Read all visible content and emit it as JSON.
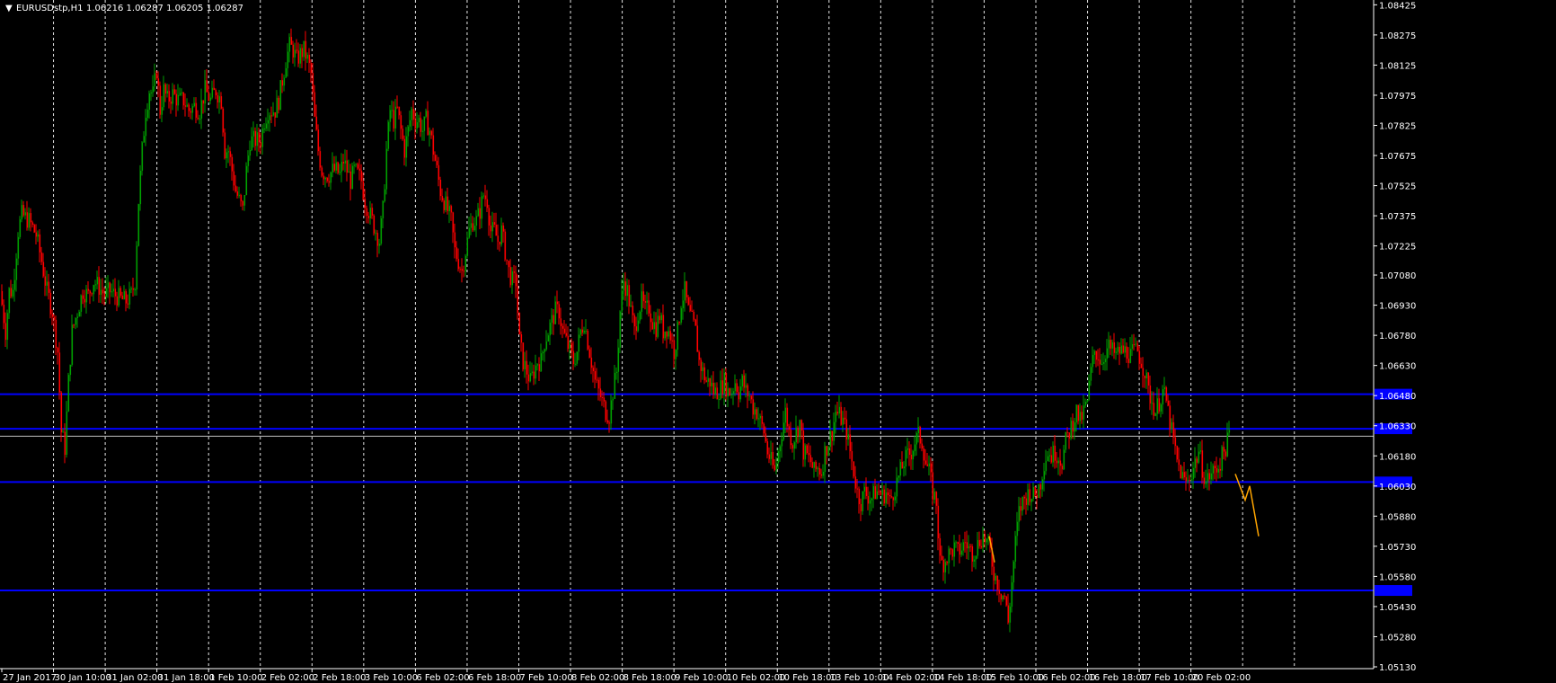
{
  "window": {
    "symbol_title": "EURUSDstp,H1",
    "ohlc_readout": "1.06216 1.06287 1.06205 1.06287",
    "menu_icon": "triangle-down-icon"
  },
  "colors": {
    "background": "#000000",
    "bull": "#00a000",
    "bear": "#ff0000",
    "grid": "#ffffff",
    "level": "#0000ff",
    "level_label_bg": "#0000ff",
    "bid_line": "#c0c0c0",
    "forecast": "#ffa500",
    "axis": "#ffffff"
  },
  "chart_data": {
    "type": "candlestick",
    "symbol": "EURUSDstp",
    "timeframe": "H1",
    "ylim": [
      1.0513,
      1.0844
    ],
    "y_ticks": [
      "1.08425",
      "1.08275",
      "1.08125",
      "1.07975",
      "1.07825",
      "1.07675",
      "1.07525",
      "1.07375",
      "1.07225",
      "1.07080",
      "1.06930",
      "1.06780",
      "1.06630",
      "1.06480",
      "1.06330",
      "1.06180",
      "1.06030",
      "1.05880",
      "1.05730",
      "1.05580",
      "1.05430",
      "1.05280",
      "1.05130"
    ],
    "x_ticks": [
      "27 Jan 2017",
      "30 Jan 10:00",
      "31 Jan 02:00",
      "31 Jan 18:00",
      "1 Feb 10:00",
      "2 Feb 02:00",
      "2 Feb 18:00",
      "3 Feb 10:00",
      "6 Feb 02:00",
      "6 Feb 18:00",
      "7 Feb 10:00",
      "8 Feb 02:00",
      "8 Feb 18:00",
      "9 Feb 10:00",
      "10 Feb 02:00",
      "10 Feb 18:00",
      "13 Feb 10:00",
      "14 Feb 02:00",
      "14 Feb 18:00",
      "15 Feb 10:00",
      "16 Feb 02:00",
      "16 Feb 18:00",
      "17 Feb 10:00",
      "20 Feb 02:00"
    ],
    "grid": "vertical dashed",
    "horizontal_levels": [
      1.06487,
      1.06315,
      1.0605,
      1.0551
    ],
    "current_price": 1.06287,
    "key_points": [
      [
        0,
        1.07
      ],
      [
        6,
        1.068
      ],
      [
        10,
        1.07
      ],
      [
        14,
        1.07
      ],
      [
        20,
        1.073
      ],
      [
        24,
        1.0738
      ],
      [
        32,
        1.0735
      ],
      [
        40,
        1.0728
      ],
      [
        46,
        1.0715
      ],
      [
        52,
        1.07
      ],
      [
        58,
        1.069
      ],
      [
        64,
        1.067
      ],
      [
        68,
        1.063
      ],
      [
        72,
        1.0622
      ],
      [
        76,
        1.0655
      ],
      [
        80,
        1.068
      ],
      [
        86,
        1.069
      ],
      [
        92,
        1.07
      ],
      [
        98,
        1.0698
      ],
      [
        104,
        1.0705
      ],
      [
        110,
        1.0702
      ],
      [
        116,
        1.0698
      ],
      [
        122,
        1.07
      ],
      [
        128,
        1.0698
      ],
      [
        134,
        1.0696
      ],
      [
        140,
        1.0695
      ],
      [
        146,
        1.0698
      ],
      [
        150,
        1.0705
      ],
      [
        154,
        1.0745
      ],
      [
        158,
        1.077
      ],
      [
        162,
        1.079
      ],
      [
        166,
        1.08
      ],
      [
        170,
        1.0798
      ],
      [
        174,
        1.081
      ],
      [
        178,
        1.079
      ],
      [
        182,
        1.08
      ],
      [
        186,
        1.0795
      ],
      [
        192,
        1.0798
      ],
      [
        198,
        1.0795
      ],
      [
        204,
        1.0795
      ],
      [
        210,
        1.079
      ],
      [
        216,
        1.0792
      ],
      [
        222,
        1.079
      ],
      [
        228,
        1.08
      ],
      [
        234,
        1.0795
      ],
      [
        240,
        1.08
      ],
      [
        246,
        1.0795
      ],
      [
        250,
        1.077
      ],
      [
        254,
        1.077
      ],
      [
        258,
        1.076
      ],
      [
        262,
        1.075
      ],
      [
        266,
        1.0745
      ],
      [
        270,
        1.074
      ],
      [
        274,
        1.076
      ],
      [
        278,
        1.0775
      ],
      [
        282,
        1.0775
      ],
      [
        286,
        1.0775
      ],
      [
        290,
        1.0775
      ],
      [
        294,
        1.0785
      ],
      [
        298,
        1.079
      ],
      [
        302,
        1.079
      ],
      [
        306,
        1.079
      ],
      [
        310,
        1.0795
      ],
      [
        314,
        1.0805
      ],
      [
        318,
        1.0815
      ],
      [
        322,
        1.0822
      ],
      [
        326,
        1.082
      ],
      [
        330,
        1.0815
      ],
      [
        334,
        1.0818
      ],
      [
        338,
        1.082
      ],
      [
        342,
        1.0815
      ],
      [
        346,
        1.0808
      ],
      [
        350,
        1.0785
      ],
      [
        354,
        1.077
      ],
      [
        358,
        1.076
      ],
      [
        362,
        1.0758
      ],
      [
        366,
        1.0758
      ],
      [
        370,
        1.076
      ],
      [
        374,
        1.076
      ],
      [
        378,
        1.0758
      ],
      [
        382,
        1.0765
      ],
      [
        386,
        1.076
      ],
      [
        390,
        1.0755
      ],
      [
        394,
        1.076
      ],
      [
        398,
        1.0758
      ],
      [
        402,
        1.0755
      ],
      [
        406,
        1.0745
      ],
      [
        410,
        1.074
      ],
      [
        414,
        1.0735
      ],
      [
        418,
        1.073
      ],
      [
        422,
        1.0725
      ],
      [
        426,
        1.074
      ],
      [
        430,
        1.077
      ],
      [
        434,
        1.079
      ],
      [
        438,
        1.0785
      ],
      [
        442,
        1.079
      ],
      [
        446,
        1.078
      ],
      [
        450,
        1.077
      ],
      [
        454,
        1.078
      ],
      [
        458,
        1.079
      ],
      [
        462,
        1.0785
      ],
      [
        466,
        1.0785
      ],
      [
        470,
        1.078
      ],
      [
        474,
        1.0785
      ],
      [
        478,
        1.078
      ],
      [
        482,
        1.077
      ],
      [
        486,
        1.076
      ],
      [
        490,
        1.075
      ],
      [
        494,
        1.0745
      ],
      [
        498,
        1.074
      ],
      [
        502,
        1.0735
      ],
      [
        506,
        1.072
      ],
      [
        510,
        1.0715
      ],
      [
        514,
        1.071
      ],
      [
        518,
        1.072
      ],
      [
        522,
        1.073
      ],
      [
        526,
        1.0735
      ],
      [
        530,
        1.0735
      ],
      [
        534,
        1.074
      ],
      [
        538,
        1.0748
      ],
      [
        542,
        1.0745
      ],
      [
        546,
        1.073
      ],
      [
        550,
        1.073
      ],
      [
        554,
        1.0725
      ],
      [
        558,
        1.073
      ],
      [
        562,
        1.072
      ],
      [
        566,
        1.071
      ],
      [
        570,
        1.0705
      ],
      [
        574,
        1.0705
      ],
      [
        578,
        1.0675
      ],
      [
        582,
        1.0665
      ],
      [
        586,
        1.066
      ],
      [
        590,
        1.0655
      ],
      [
        594,
        1.066
      ],
      [
        598,
        1.0665
      ],
      [
        602,
        1.0665
      ],
      [
        606,
        1.0675
      ],
      [
        610,
        1.068
      ],
      [
        614,
        1.0685
      ],
      [
        618,
        1.069
      ],
      [
        622,
        1.069
      ],
      [
        626,
        1.068
      ],
      [
        630,
        1.0675
      ],
      [
        634,
        1.067
      ],
      [
        638,
        1.0665
      ],
      [
        642,
        1.067
      ],
      [
        646,
        1.068
      ],
      [
        650,
        1.0685
      ],
      [
        654,
        1.0675
      ],
      [
        658,
        1.0665
      ],
      [
        662,
        1.0655
      ],
      [
        666,
        1.065
      ],
      [
        670,
        1.0645
      ],
      [
        674,
        1.064
      ],
      [
        678,
        1.0638
      ],
      [
        682,
        1.065
      ],
      [
        686,
        1.066
      ],
      [
        690,
        1.069
      ],
      [
        694,
        1.0705
      ],
      [
        698,
        1.07
      ],
      [
        702,
        1.069
      ],
      [
        706,
        1.068
      ],
      [
        710,
        1.069
      ],
      [
        714,
        1.0695
      ],
      [
        718,
        1.069
      ],
      [
        722,
        1.0692
      ],
      [
        726,
        1.0685
      ],
      [
        730,
        1.0682
      ],
      [
        734,
        1.0688
      ],
      [
        738,
        1.068
      ],
      [
        742,
        1.0682
      ],
      [
        746,
        1.0678
      ],
      [
        750,
        1.067
      ],
      [
        754,
        1.068
      ],
      [
        758,
        1.0695
      ],
      [
        762,
        1.07
      ],
      [
        766,
        1.069
      ],
      [
        770,
        1.0685
      ],
      [
        774,
        1.068
      ],
      [
        778,
        1.0665
      ],
      [
        782,
        1.066
      ],
      [
        786,
        1.0655
      ],
      [
        790,
        1.0655
      ],
      [
        794,
        1.065
      ],
      [
        798,
        1.065
      ],
      [
        802,
        1.0652
      ],
      [
        806,
        1.0655
      ],
      [
        810,
        1.065
      ],
      [
        814,
        1.065
      ],
      [
        818,
        1.0655
      ],
      [
        822,
        1.065
      ],
      [
        826,
        1.0655
      ],
      [
        830,
        1.065
      ],
      [
        834,
        1.0648
      ],
      [
        838,
        1.0642
      ],
      [
        842,
        1.064
      ],
      [
        846,
        1.0635
      ],
      [
        850,
        1.063
      ],
      [
        854,
        1.062
      ],
      [
        858,
        1.0615
      ],
      [
        862,
        1.061
      ],
      [
        866,
        1.062
      ],
      [
        870,
        1.063
      ],
      [
        874,
        1.064
      ],
      [
        878,
        1.063
      ],
      [
        882,
        1.0625
      ],
      [
        886,
        1.063
      ],
      [
        890,
        1.0635
      ],
      [
        894,
        1.062
      ],
      [
        898,
        1.0618
      ],
      [
        902,
        1.0615
      ],
      [
        906,
        1.061
      ],
      [
        910,
        1.0612
      ],
      [
        914,
        1.061
      ],
      [
        918,
        1.062
      ],
      [
        922,
        1.0625
      ],
      [
        926,
        1.063
      ],
      [
        930,
        1.064
      ],
      [
        934,
        1.0638
      ],
      [
        938,
        1.0635
      ],
      [
        942,
        1.063
      ],
      [
        946,
        1.062
      ],
      [
        950,
        1.061
      ],
      [
        954,
        1.06
      ],
      [
        958,
        1.0595
      ],
      [
        962,
        1.06
      ],
      [
        966,
        1.0598
      ],
      [
        970,
        1.0597
      ],
      [
        974,
        1.06
      ],
      [
        978,
        1.06
      ],
      [
        982,
        1.0598
      ],
      [
        986,
        1.06
      ],
      [
        990,
        1.0595
      ],
      [
        994,
        1.06
      ],
      [
        998,
        1.0605
      ],
      [
        1002,
        1.061
      ],
      [
        1006,
        1.0615
      ],
      [
        1010,
        1.0618
      ],
      [
        1014,
        1.062
      ],
      [
        1018,
        1.0625
      ],
      [
        1022,
        1.0628
      ],
      [
        1026,
        1.0625
      ],
      [
        1030,
        1.0615
      ],
      [
        1034,
        1.061
      ],
      [
        1038,
        1.06
      ],
      [
        1042,
        1.0595
      ],
      [
        1046,
        1.0565
      ],
      [
        1050,
        1.0565
      ],
      [
        1054,
        1.0568
      ],
      [
        1058,
        1.057
      ],
      [
        1062,
        1.0572
      ],
      [
        1066,
        1.057
      ],
      [
        1070,
        1.0572
      ],
      [
        1074,
        1.0575
      ],
      [
        1078,
        1.0572
      ],
      [
        1082,
        1.057
      ],
      [
        1086,
        1.0572
      ],
      [
        1090,
        1.0576
      ],
      [
        1094,
        1.0578
      ],
      [
        1098,
        1.0575
      ],
      [
        1102,
        1.057
      ],
      [
        1106,
        1.056
      ],
      [
        1110,
        1.0555
      ],
      [
        1114,
        1.055
      ],
      [
        1118,
        1.0548
      ],
      [
        1122,
        1.0535
      ],
      [
        1126,
        1.0555
      ],
      [
        1130,
        1.0575
      ],
      [
        1134,
        1.059
      ],
      [
        1138,
        1.0595
      ],
      [
        1142,
        1.0598
      ],
      [
        1146,
        1.06
      ],
      [
        1150,
        1.0598
      ],
      [
        1154,
        1.06
      ],
      [
        1158,
        1.0605
      ],
      [
        1162,
        1.0615
      ],
      [
        1166,
        1.062
      ],
      [
        1170,
        1.0618
      ],
      [
        1174,
        1.062
      ],
      [
        1178,
        1.0618
      ],
      [
        1182,
        1.0615
      ],
      [
        1186,
        1.0625
      ],
      [
        1190,
        1.063
      ],
      [
        1194,
        1.0635
      ],
      [
        1198,
        1.064
      ],
      [
        1202,
        1.0635
      ],
      [
        1206,
        1.064
      ],
      [
        1210,
        1.0645
      ],
      [
        1214,
        1.066
      ],
      [
        1218,
        1.067
      ],
      [
        1222,
        1.0668
      ],
      [
        1226,
        1.0665
      ],
      [
        1230,
        1.067
      ],
      [
        1234,
        1.0672
      ],
      [
        1238,
        1.067
      ],
      [
        1242,
        1.0668
      ],
      [
        1246,
        1.067
      ],
      [
        1250,
        1.067
      ],
      [
        1254,
        1.067
      ],
      [
        1258,
        1.0668
      ],
      [
        1262,
        1.067
      ],
      [
        1266,
        1.067
      ],
      [
        1270,
        1.0665
      ],
      [
        1274,
        1.066
      ],
      [
        1278,
        1.065
      ],
      [
        1282,
        1.0645
      ],
      [
        1286,
        1.064
      ],
      [
        1290,
        1.0645
      ],
      [
        1294,
        1.065
      ],
      [
        1298,
        1.0645
      ],
      [
        1302,
        1.0635
      ],
      [
        1306,
        1.0625
      ],
      [
        1310,
        1.0615
      ],
      [
        1314,
        1.061
      ],
      [
        1318,
        1.0605
      ],
      [
        1322,
        1.0605
      ],
      [
        1326,
        1.061
      ],
      [
        1330,
        1.0615
      ],
      [
        1334,
        1.062
      ],
      [
        1338,
        1.0612
      ],
      [
        1342,
        1.0605
      ],
      [
        1346,
        1.0608
      ],
      [
        1350,
        1.061
      ],
      [
        1354,
        1.0612
      ],
      [
        1358,
        1.0615
      ],
      [
        1362,
        1.062
      ],
      [
        1366,
        1.0625
      ],
      [
        1368,
        1.06287
      ]
    ],
    "forecast_path": [
      [
        1375,
        1.0609
      ],
      [
        1386,
        1.0596
      ],
      [
        1391,
        1.0603
      ],
      [
        1401,
        1.0578
      ]
    ],
    "small_forecast_path": [
      [
        1101,
        1.0578
      ],
      [
        1107,
        1.0565
      ]
    ]
  }
}
